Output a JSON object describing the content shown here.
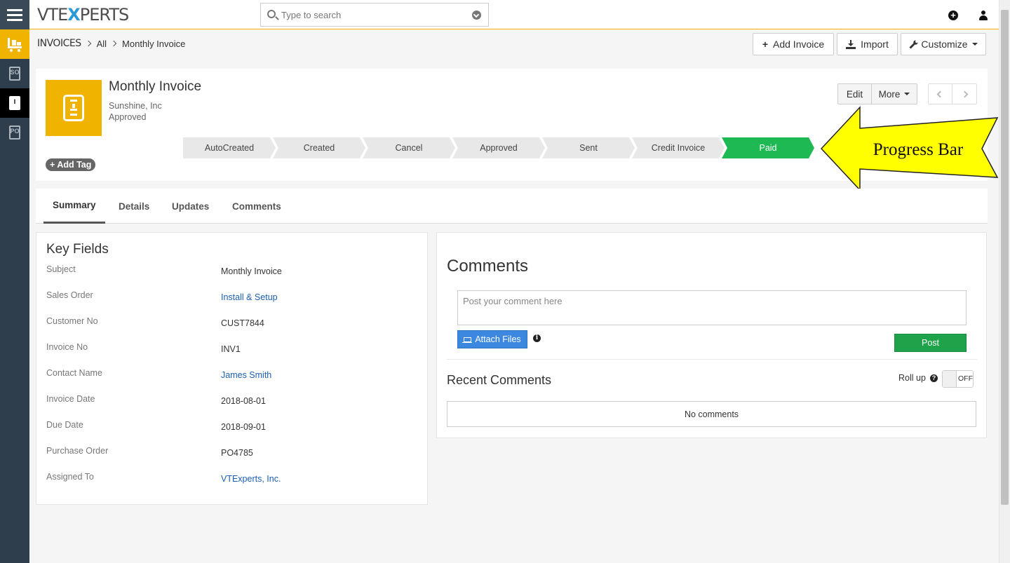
{
  "topbar": {
    "logo_left": "VTE",
    "logo_x": "X",
    "logo_right": "PERTS",
    "search_placeholder": "Type to search",
    "add_symbol": "+"
  },
  "sidebar": {
    "items": [
      {
        "name": "inventory-module",
        "label": ""
      },
      {
        "name": "sales-order",
        "label": "SO"
      },
      {
        "name": "invoice",
        "label": "I"
      },
      {
        "name": "purchase-order",
        "label": "PO"
      }
    ]
  },
  "breadcrumb": {
    "module": "INVOICES",
    "filter": "All",
    "record": "Monthly Invoice"
  },
  "header_actions": {
    "add_invoice": "Add Invoice",
    "import": "Import",
    "customize": "Customize"
  },
  "record": {
    "title": "Monthly Invoice",
    "organization": "Sunshine, Inc",
    "status": "Approved",
    "add_tag": "Add Tag",
    "edit": "Edit",
    "more": "More"
  },
  "progress": {
    "steps": [
      "AutoCreated",
      "Created",
      "Cancel",
      "Approved",
      "Sent",
      "Credit Invoice",
      "Paid"
    ],
    "active": "Paid",
    "active_color": "#1fb954"
  },
  "annotation": {
    "text": "Progress Bar",
    "color": "#ffff00"
  },
  "tabs": [
    "Summary",
    "Details",
    "Updates",
    "Comments"
  ],
  "active_tab": "Summary",
  "key_fields": {
    "title": "Key Fields",
    "rows": [
      {
        "label": "Subject",
        "value": "Monthly Invoice",
        "link": false
      },
      {
        "label": "Sales Order",
        "value": "Install & Setup",
        "link": true
      },
      {
        "label": "Customer No",
        "value": "CUST7844",
        "link": false
      },
      {
        "label": "Invoice No",
        "value": "INV1",
        "link": false
      },
      {
        "label": "Contact Name",
        "value": "James Smith",
        "link": true
      },
      {
        "label": "Invoice Date",
        "value": "2018-08-01",
        "link": false
      },
      {
        "label": "Due Date",
        "value": "2018-09-01",
        "link": false
      },
      {
        "label": "Purchase Order",
        "value": "PO4785",
        "link": false
      },
      {
        "label": "Assigned To",
        "value": "VTExperts, Inc.",
        "link": true
      }
    ]
  },
  "comments": {
    "title": "Comments",
    "placeholder": "Post your comment here",
    "attach_files": "Attach Files",
    "post": "Post",
    "recent_title": "Recent Comments",
    "roll_up": "Roll up",
    "toggle_state": "OFF",
    "empty_text": "No comments"
  },
  "colors": {
    "accent": "#f0b400",
    "sidebar": "#2f3e4c",
    "link": "#1a5fb4",
    "post_button": "#1fa34a",
    "attach_button": "#3c87e0"
  }
}
